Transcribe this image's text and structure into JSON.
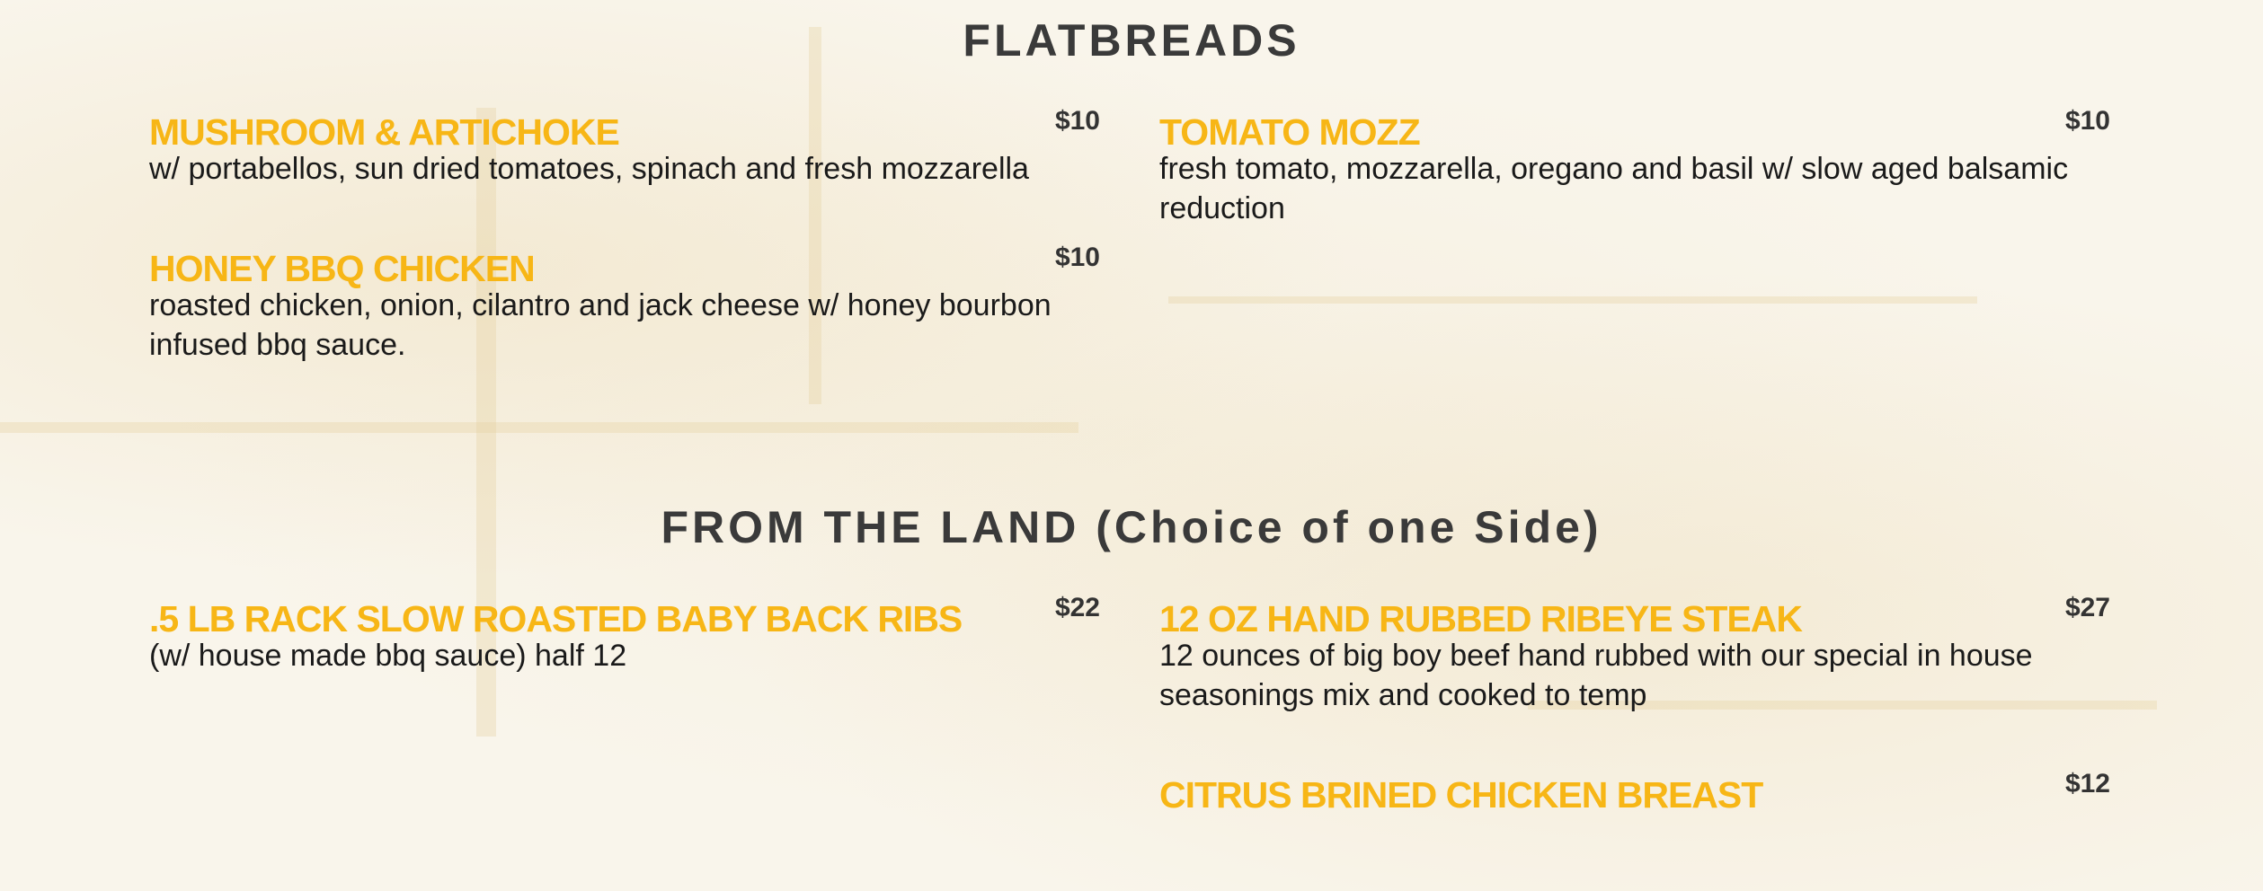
{
  "sections": [
    {
      "title": "FLATBREADS",
      "items": [
        {
          "name": "MUSHROOM & ARTICHOKE",
          "price": "$10",
          "description": "w/ portabellos, sun dried tomatoes, spinach and fresh mozzarella"
        },
        {
          "name": "TOMATO MOZZ",
          "price": "$10",
          "description": "fresh tomato, mozzarella, oregano and basil w/ slow aged balsamic reduction"
        },
        {
          "name": "HONEY BBQ CHICKEN",
          "price": "$10",
          "description": "roasted chicken, onion, cilantro and jack cheese w/ honey bourbon infused bbq sauce."
        }
      ]
    },
    {
      "title": "FROM THE LAND (Choice of one Side)",
      "items": [
        {
          "name": ".5 LB RACK SLOW ROASTED BABY BACK RIBS",
          "price": "$22",
          "description": "(w/ house made bbq sauce) half 12"
        },
        {
          "name": "12 OZ HAND RUBBED RIBEYE STEAK",
          "price": "$27",
          "description": "12 ounces of big boy beef hand rubbed with our special in house seasonings mix and cooked to temp"
        },
        {
          "name": "CITRUS BRINED CHICKEN BREAST",
          "price": "$12",
          "description": ""
        }
      ]
    }
  ],
  "colors": {
    "background": "#f9f5eb",
    "item_name": "#f7b616",
    "section_title": "#3a3a3a",
    "price": "#333333",
    "description": "#1a1a1a"
  }
}
